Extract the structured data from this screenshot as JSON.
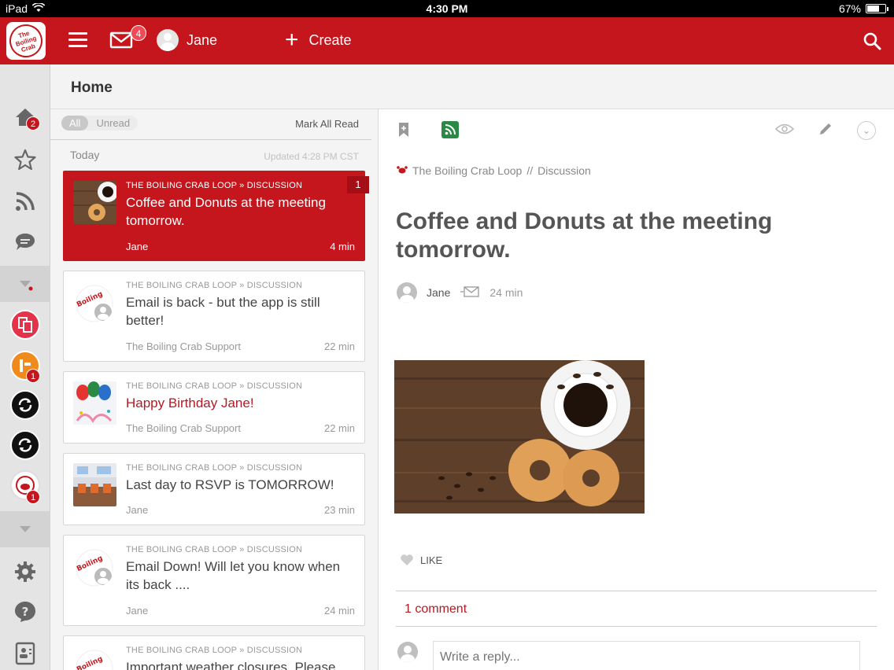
{
  "status_bar": {
    "device": "iPad",
    "time": "4:30 PM",
    "battery": "67%",
    "battery_level": 0.67
  },
  "topbar": {
    "logo_text": "The Boiling Crab",
    "inbox_badge": "4",
    "user_name": "Jane",
    "create_label": "Create",
    "accent_color": "#c4161c"
  },
  "sidebar": {
    "home_badge": "2",
    "app_badges": [
      "1",
      "1"
    ]
  },
  "home": {
    "title": "Home"
  },
  "list": {
    "filter_all": "All",
    "filter_unread": "Unread",
    "mark_all_read": "Mark All Read",
    "section": "Today",
    "updated": "Updated 4:28 PM CST",
    "items": [
      {
        "crumb": "The Boiling Crab Loop » Discussion",
        "title": "Coffee and Donuts at the meeting tomorrow.",
        "author": "Jane",
        "time": "4 min",
        "count": "1"
      },
      {
        "crumb": "The Boiling Crab Loop » Discussion",
        "title": "Email is back - but the app is still better!",
        "author": "The Boiling Crab Support",
        "time": "22 min"
      },
      {
        "crumb": "The Boiling Crab Loop » Discussion",
        "title": "Happy Birthday Jane!",
        "author": "The Boiling Crab Support",
        "time": "22 min"
      },
      {
        "crumb": "The Boiling Crab Loop » Discussion",
        "title": "Last day to RSVP is TOMORROW!",
        "author": "Jane",
        "time": "23 min"
      },
      {
        "crumb": "The Boiling Crab Loop » Discussion",
        "title": "Email Down! Will let you know when its back ....",
        "author": "Jane",
        "time": "24 min"
      },
      {
        "crumb": "The Boiling Crab Loop » Discussion",
        "title": "Important weather closures. Please"
      }
    ]
  },
  "detail": {
    "crumb_group": "The Boiling Crab Loop",
    "crumb_sep": "//",
    "crumb_type": "Discussion",
    "title": "Coffee and Donuts at the meeting tomorrow.",
    "author": "Jane",
    "time": "24 min",
    "like_label": "LIKE",
    "comments_count": "1 comment",
    "reply_placeholder": "Write a reply..."
  }
}
